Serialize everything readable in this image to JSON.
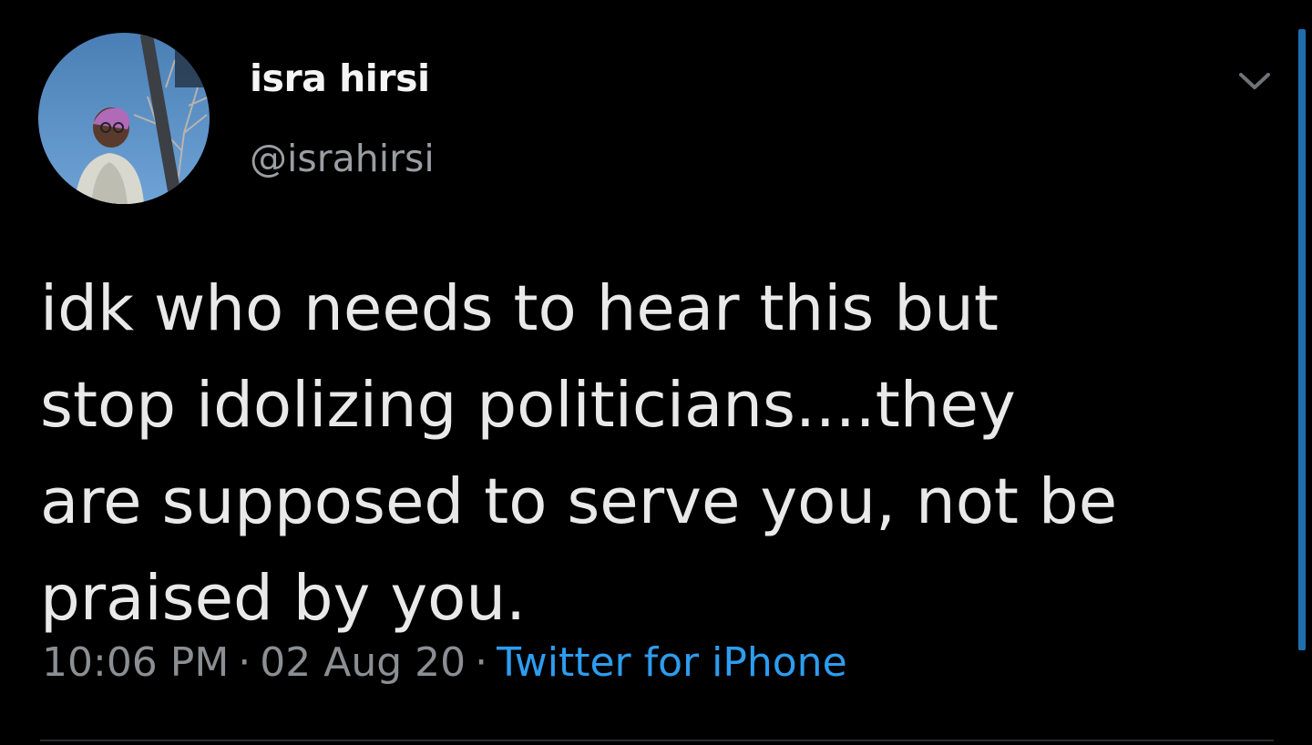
{
  "tweet": {
    "author": {
      "display_name": "isra hirsi",
      "handle": "@israhirsi",
      "avatar_icon": "profile-photo"
    },
    "text": "idk who needs to hear this but\nstop idolizing politicians....they\nare supposed to serve you, not be\npraised by you.",
    "time": "10:06 PM",
    "date": "02 Aug 20",
    "separator": "·",
    "source": "Twitter for iPhone",
    "menu_icon": "chevron-down-icon"
  },
  "colors": {
    "background": "#000000",
    "text": "#e9e9e9",
    "muted": "#8b8f94",
    "link": "#2d9df0",
    "scrollbar": "#1d6fb0"
  }
}
